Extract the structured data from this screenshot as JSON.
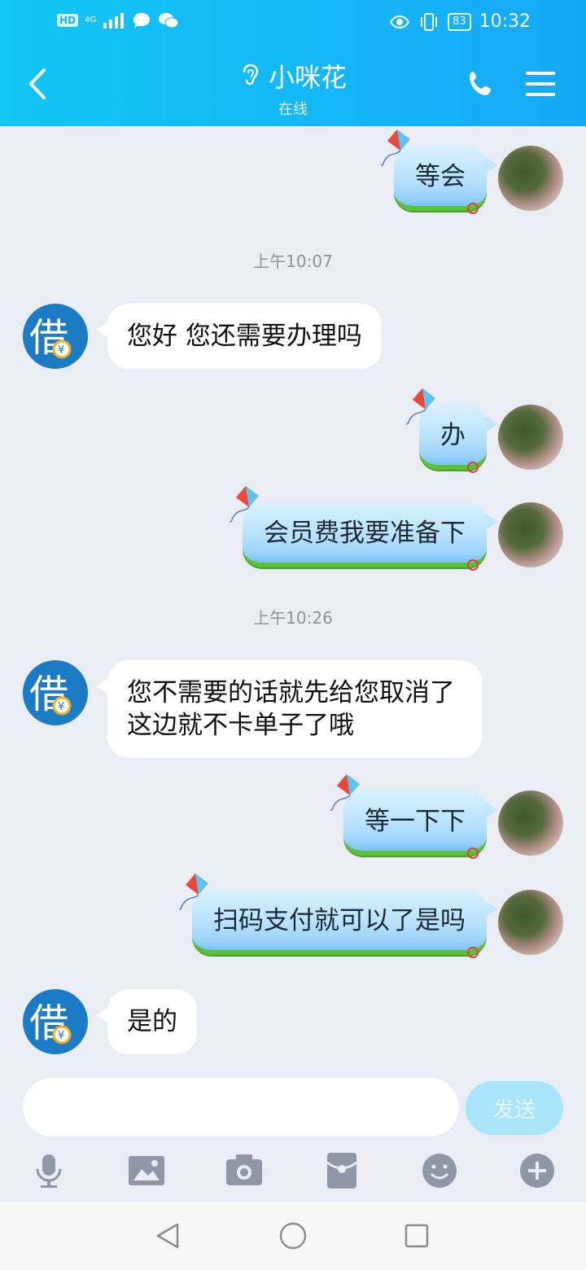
{
  "status_bar": {
    "left_badges": [
      "HD",
      "4G"
    ],
    "battery": "83",
    "time": "10:32"
  },
  "header": {
    "title": "小咪花",
    "subtitle": "在线",
    "icons": [
      "back-icon",
      "ear-icon",
      "phone-icon",
      "menu-icon"
    ]
  },
  "messages": [
    {
      "from": "me",
      "text": "等会"
    },
    {
      "type": "timestamp",
      "text": "上午10:07"
    },
    {
      "from": "them",
      "text": "您好 您还需要办理吗"
    },
    {
      "from": "me",
      "text": "办"
    },
    {
      "from": "me",
      "text": "会员费我要准备下"
    },
    {
      "type": "timestamp",
      "text": "上午10:26"
    },
    {
      "from": "them",
      "text": "您不需要的话就先给您取消了 这边就不卡单子了哦"
    },
    {
      "from": "me",
      "text": "等一下下"
    },
    {
      "from": "me",
      "text": "扫码支付就可以了是吗"
    },
    {
      "from": "them",
      "text": "是的"
    }
  ],
  "input": {
    "value": "",
    "placeholder": "",
    "send_label": "发送"
  },
  "toolbar": [
    "microphone-icon",
    "image-icon",
    "camera-icon",
    "red-packet-icon",
    "emoji-icon",
    "plus-icon"
  ],
  "navbar": [
    "back-triangle-icon",
    "home-circle-icon",
    "recents-square-icon"
  ],
  "colors": {
    "header": "#14b9f7",
    "bubble_them": "#ffffff",
    "bubble_me": "#b8e2fd",
    "send_disabled": "#a9e4fb"
  }
}
